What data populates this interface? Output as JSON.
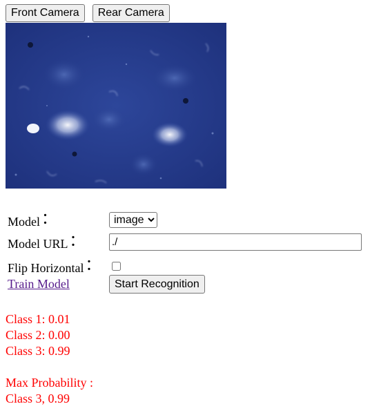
{
  "camera_controls": {
    "front_label": "Front Camera",
    "rear_label": "Rear Camera"
  },
  "form": {
    "model_label": "Model",
    "model_colon": "：",
    "model_options": [
      "image"
    ],
    "model_selected": "image",
    "model_url_label": "Model URL",
    "model_url_colon": "：",
    "model_url_value": "./",
    "flip_label": "Flip Horizontal",
    "flip_colon": "：",
    "flip_checked": false,
    "train_link": "Train Model",
    "start_button": "Start Recognition"
  },
  "results": {
    "classes": [
      {
        "label": "Class 1: 0.01"
      },
      {
        "label": "Class 2: 0.00"
      },
      {
        "label": "Class 3: 0.99"
      }
    ],
    "max_title": "Max Probability :",
    "max_value": "Class 3, 0.99"
  },
  "colors": {
    "result_text": "#ff0000",
    "link": "#551a8b",
    "camera_bg": "#2a3f8f"
  }
}
